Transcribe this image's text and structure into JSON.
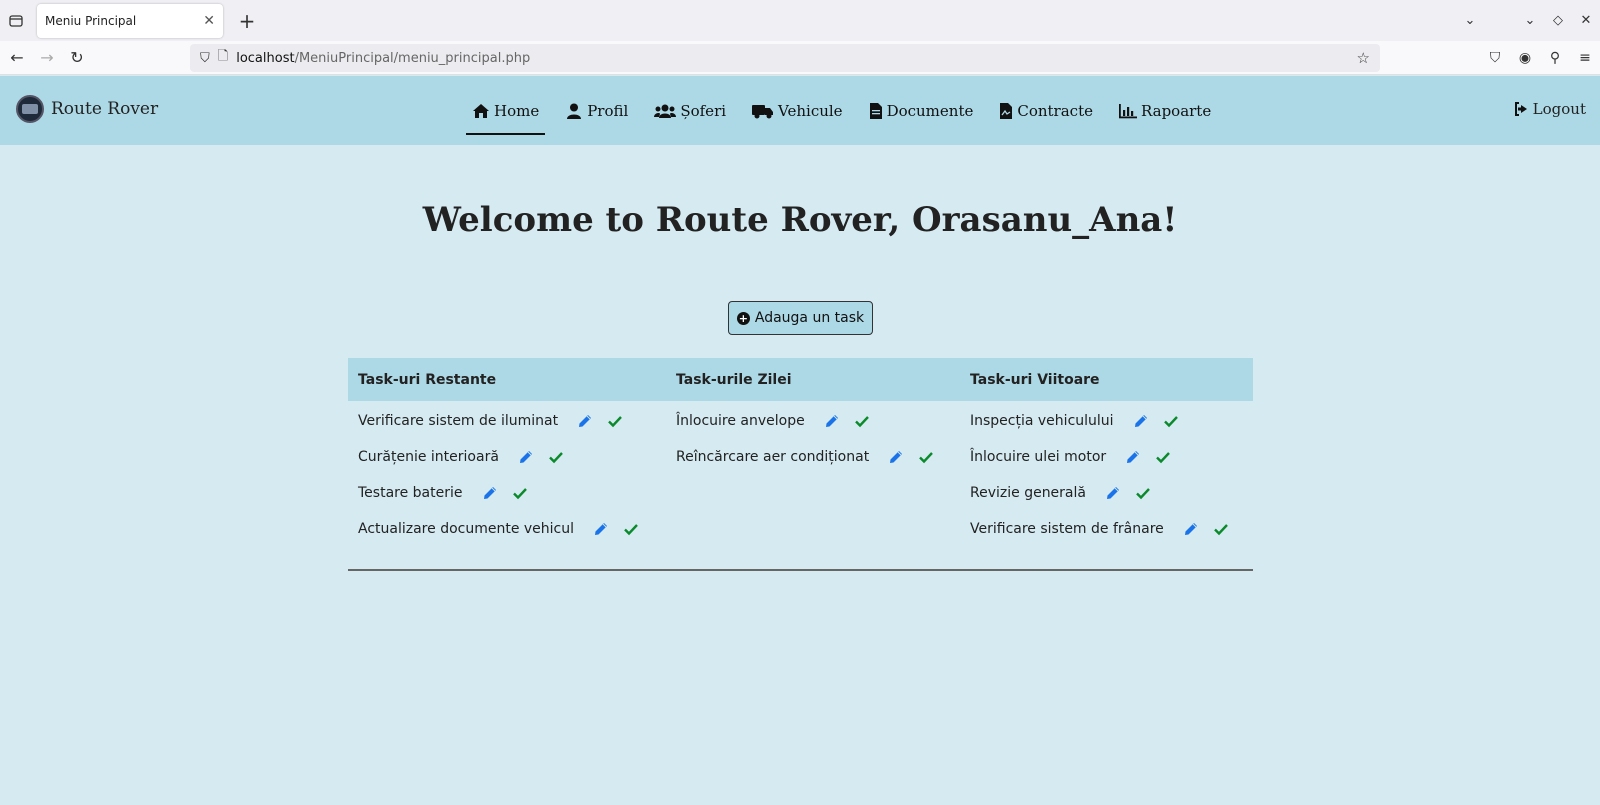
{
  "browser": {
    "tab_title": "Meniu Principal",
    "url_host": "localhost",
    "url_path": "/MeniuPrincipal/meniu_principal.php"
  },
  "header": {
    "brand": "Route Rover",
    "nav": [
      {
        "label": "Home",
        "icon": "home-icon"
      },
      {
        "label": "Profil",
        "icon": "user-icon"
      },
      {
        "label": "Șoferi",
        "icon": "users-icon"
      },
      {
        "label": "Vehicule",
        "icon": "truck-icon"
      },
      {
        "label": "Documente",
        "icon": "document-icon"
      },
      {
        "label": "Contracte",
        "icon": "contract-icon"
      },
      {
        "label": "Rapoarte",
        "icon": "chart-icon"
      }
    ],
    "logout": "Logout"
  },
  "main": {
    "welcome": "Welcome to Route Rover, Orasanu_Ana!",
    "add_task": "Adauga un task",
    "columns": [
      {
        "title": "Task-uri Restante",
        "tasks": [
          "Verificare sistem de iluminat",
          "Curățenie interioară",
          "Testare baterie",
          "Actualizare documente vehicul"
        ]
      },
      {
        "title": "Task-urile Zilei",
        "tasks": [
          "Înlocuire anvelope",
          "Reîncărcare aer condiționat"
        ]
      },
      {
        "title": "Task-uri Viitoare",
        "tasks": [
          "Inspecția vehiculului",
          "Înlocuire ulei motor",
          "Revizie generală",
          "Verificare sistem de frânare"
        ]
      }
    ]
  },
  "colors": {
    "header_bg": "#add8e6",
    "page_bg": "#d6eaf1",
    "edit_icon": "#1a73e8",
    "check_icon": "#0a8a2a"
  }
}
